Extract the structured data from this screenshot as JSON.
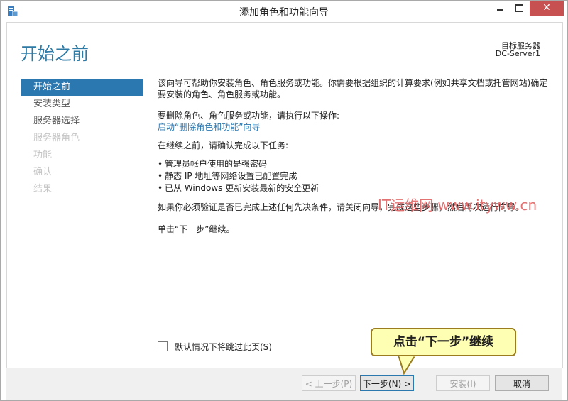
{
  "window": {
    "title": "添加角色和功能向导",
    "minimize_glyph": "",
    "maximize_glyph": "",
    "close_glyph": "✕"
  },
  "header": {
    "page_title": "开始之前",
    "destination_label": "目标服务器",
    "destination_server": "DC-Server1"
  },
  "nav": {
    "items": [
      {
        "label": "开始之前",
        "state": "active"
      },
      {
        "label": "安装类型",
        "state": "normal"
      },
      {
        "label": "服务器选择",
        "state": "normal"
      },
      {
        "label": "服务器角色",
        "state": "disabled"
      },
      {
        "label": "功能",
        "state": "disabled"
      },
      {
        "label": "确认",
        "state": "disabled"
      },
      {
        "label": "结果",
        "state": "disabled"
      }
    ]
  },
  "main": {
    "intro": "该向导可帮助你安装角色、角色服务或功能。你需要根据组织的计算要求(例如共享文档或托管网站)确定要安装的角色、角色服务或功能。",
    "remove_instruction": "要删除角色、角色服务或功能，请执行以下操作:",
    "remove_link": "启动“删除角色和功能”向导",
    "before_continue": "在继续之前，请确认完成以下任务:",
    "tasks": [
      "管理员帐户使用的是强密码",
      "静态 IP 地址等网络设置已配置完成",
      "已从 Windows 更新安装最新的安全更新"
    ],
    "verify_note": "如果你必须验证是否已完成上述任何先决条件，请关闭向导，完成这些步骤，然后再次运行向导。",
    "continue_note": "单击“下一步”继续。",
    "skip_checkbox_label": "默认情况下将跳过此页(S)"
  },
  "footer": {
    "prev_label": "< 上一步(P)",
    "next_label": "下一步(N) >",
    "install_label": "安装(I)",
    "cancel_label": "取消"
  },
  "annotation": {
    "callout_text": "点击“下一步”继续",
    "watermark": "IT运维网 www.ityww.cn"
  },
  "colors": {
    "accent": "#2b78b1",
    "heading": "#2d7aa6",
    "close_button": "#c75050",
    "callout_bg": "#ffffb4",
    "watermark": "#e06464"
  }
}
